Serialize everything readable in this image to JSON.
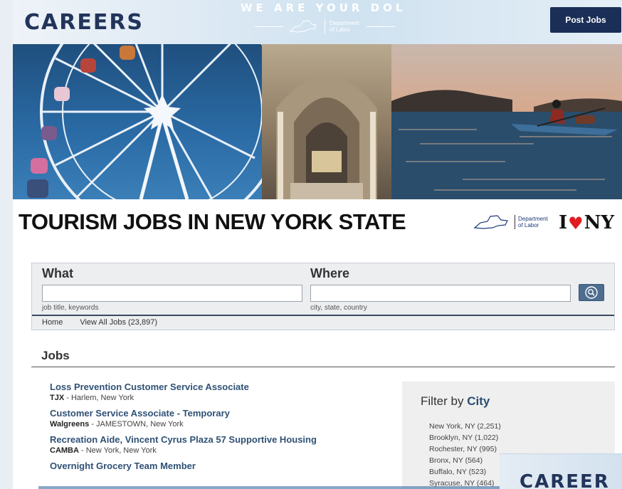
{
  "header": {
    "brand": "CAREERS",
    "tagline": "WE ARE YOUR DOL",
    "dol_logo_text": "Department of Labor",
    "post_jobs_label": "Post Jobs"
  },
  "hero": {
    "panels": [
      "ferris-wheel-photo",
      "museum-hall-photo",
      "kayak-lake-photo"
    ]
  },
  "banner": {
    "title": "TOURISM JOBS IN NEW YORK STATE",
    "dol_logo_text": "Department of Labor",
    "ilny_i": "I",
    "ilny_heart": "♥",
    "ilny_ny": "NY"
  },
  "search": {
    "what_label": "What",
    "where_label": "Where",
    "what_value": "",
    "where_value": "",
    "what_hint": "job title, keywords",
    "where_hint": "city, state, country",
    "button_icon": "search-icon",
    "breadcrumb_home": "Home",
    "breadcrumb_view_all": "View All Jobs (23,897)"
  },
  "jobs": {
    "heading": "Jobs",
    "items": [
      {
        "title": "Loss Prevention Customer Service Associate",
        "company": "TJX",
        "location": " - Harlem, New York"
      },
      {
        "title": "Customer Service Associate - Temporary",
        "company": "Walgreens",
        "location": " - JAMESTOWN, New York"
      },
      {
        "title": "Recreation Aide, Vincent Cyrus Plaza 57 Supportive Housing",
        "company": "CAMBA",
        "location": " - New York, New York"
      },
      {
        "title": "Overnight Grocery Team Member",
        "company": "",
        "location": ""
      }
    ]
  },
  "filter": {
    "heading_prefix": "Filter by ",
    "heading_strong": "City",
    "cities": [
      "New York, NY (2,251)",
      "Brooklyn, NY (1,022)",
      "Rochester, NY (995)",
      "Bronx, NY (564)",
      "Buffalo, NY (523)",
      "Syracuse, NY (464)"
    ]
  },
  "overlay": {
    "brand": "CAREER"
  },
  "colors": {
    "brand_navy": "#22345a",
    "button_navy": "#1b2e57",
    "link_blue": "#2f5175",
    "heart_red": "#e11b22"
  }
}
